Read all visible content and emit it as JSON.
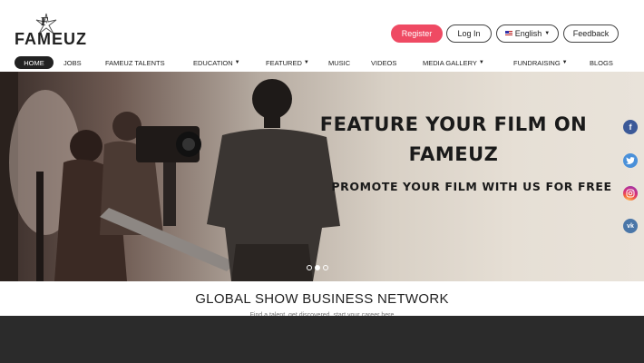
{
  "logo": {
    "letter": "F",
    "word": "FAMEUZ"
  },
  "header": {
    "register_label": "Register",
    "login_label": "Log In",
    "language_label": "English",
    "feedback_label": "Feedback"
  },
  "nav": {
    "items": [
      {
        "label": "HOME",
        "dropdown": false
      },
      {
        "label": "JOBS",
        "dropdown": false
      },
      {
        "label": "FAMEUZ TALENTS",
        "dropdown": false
      },
      {
        "label": "EDUCATION",
        "dropdown": true
      },
      {
        "label": "FEATURED",
        "dropdown": true
      },
      {
        "label": "MUSIC",
        "dropdown": false
      },
      {
        "label": "VIDEOS",
        "dropdown": false
      },
      {
        "label": "MEDIA GALLERY",
        "dropdown": true
      },
      {
        "label": "FUNDRAISING",
        "dropdown": true
      },
      {
        "label": "BLOGS",
        "dropdown": false
      }
    ]
  },
  "hero": {
    "title_line1": "FEATURE YOUR FILM ON",
    "title_line2": "FAMEUZ",
    "subtitle": "PROMOTE YOUR FILM WITH US FOR FREE",
    "slides": 3,
    "active_slide": 2
  },
  "social": [
    "facebook-icon",
    "twitter-icon",
    "instagram-icon",
    "vk-icon"
  ],
  "section": {
    "title": "GLOBAL SHOW BUSINESS NETWORK",
    "subtitle": "Find a talent, get discovered, start your career here"
  },
  "colors": {
    "accent": "#ef4a63",
    "nav_active": "#222222",
    "footer": "#2b2b2b"
  }
}
